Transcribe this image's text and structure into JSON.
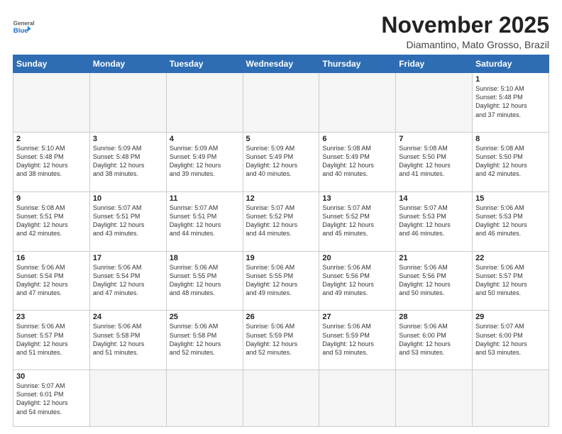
{
  "header": {
    "logo_line1": "General",
    "logo_line2": "Blue",
    "title": "November 2025",
    "subtitle": "Diamantino, Mato Grosso, Brazil"
  },
  "days_of_week": [
    "Sunday",
    "Monday",
    "Tuesday",
    "Wednesday",
    "Thursday",
    "Friday",
    "Saturday"
  ],
  "weeks": [
    [
      {
        "day": "",
        "info": ""
      },
      {
        "day": "",
        "info": ""
      },
      {
        "day": "",
        "info": ""
      },
      {
        "day": "",
        "info": ""
      },
      {
        "day": "",
        "info": ""
      },
      {
        "day": "",
        "info": ""
      },
      {
        "day": "1",
        "info": "Sunrise: 5:10 AM\nSunset: 5:48 PM\nDaylight: 12 hours\nand 37 minutes."
      }
    ],
    [
      {
        "day": "2",
        "info": "Sunrise: 5:10 AM\nSunset: 5:48 PM\nDaylight: 12 hours\nand 38 minutes."
      },
      {
        "day": "3",
        "info": "Sunrise: 5:09 AM\nSunset: 5:48 PM\nDaylight: 12 hours\nand 38 minutes."
      },
      {
        "day": "4",
        "info": "Sunrise: 5:09 AM\nSunset: 5:49 PM\nDaylight: 12 hours\nand 39 minutes."
      },
      {
        "day": "5",
        "info": "Sunrise: 5:09 AM\nSunset: 5:49 PM\nDaylight: 12 hours\nand 40 minutes."
      },
      {
        "day": "6",
        "info": "Sunrise: 5:08 AM\nSunset: 5:49 PM\nDaylight: 12 hours\nand 40 minutes."
      },
      {
        "day": "7",
        "info": "Sunrise: 5:08 AM\nSunset: 5:50 PM\nDaylight: 12 hours\nand 41 minutes."
      },
      {
        "day": "8",
        "info": "Sunrise: 5:08 AM\nSunset: 5:50 PM\nDaylight: 12 hours\nand 42 minutes."
      }
    ],
    [
      {
        "day": "9",
        "info": "Sunrise: 5:08 AM\nSunset: 5:51 PM\nDaylight: 12 hours\nand 42 minutes."
      },
      {
        "day": "10",
        "info": "Sunrise: 5:07 AM\nSunset: 5:51 PM\nDaylight: 12 hours\nand 43 minutes."
      },
      {
        "day": "11",
        "info": "Sunrise: 5:07 AM\nSunset: 5:51 PM\nDaylight: 12 hours\nand 44 minutes."
      },
      {
        "day": "12",
        "info": "Sunrise: 5:07 AM\nSunset: 5:52 PM\nDaylight: 12 hours\nand 44 minutes."
      },
      {
        "day": "13",
        "info": "Sunrise: 5:07 AM\nSunset: 5:52 PM\nDaylight: 12 hours\nand 45 minutes."
      },
      {
        "day": "14",
        "info": "Sunrise: 5:07 AM\nSunset: 5:53 PM\nDaylight: 12 hours\nand 46 minutes."
      },
      {
        "day": "15",
        "info": "Sunrise: 5:06 AM\nSunset: 5:53 PM\nDaylight: 12 hours\nand 46 minutes."
      }
    ],
    [
      {
        "day": "16",
        "info": "Sunrise: 5:06 AM\nSunset: 5:54 PM\nDaylight: 12 hours\nand 47 minutes."
      },
      {
        "day": "17",
        "info": "Sunrise: 5:06 AM\nSunset: 5:54 PM\nDaylight: 12 hours\nand 47 minutes."
      },
      {
        "day": "18",
        "info": "Sunrise: 5:06 AM\nSunset: 5:55 PM\nDaylight: 12 hours\nand 48 minutes."
      },
      {
        "day": "19",
        "info": "Sunrise: 5:06 AM\nSunset: 5:55 PM\nDaylight: 12 hours\nand 49 minutes."
      },
      {
        "day": "20",
        "info": "Sunrise: 5:06 AM\nSunset: 5:56 PM\nDaylight: 12 hours\nand 49 minutes."
      },
      {
        "day": "21",
        "info": "Sunrise: 5:06 AM\nSunset: 5:56 PM\nDaylight: 12 hours\nand 50 minutes."
      },
      {
        "day": "22",
        "info": "Sunrise: 5:06 AM\nSunset: 5:57 PM\nDaylight: 12 hours\nand 50 minutes."
      }
    ],
    [
      {
        "day": "23",
        "info": "Sunrise: 5:06 AM\nSunset: 5:57 PM\nDaylight: 12 hours\nand 51 minutes."
      },
      {
        "day": "24",
        "info": "Sunrise: 5:06 AM\nSunset: 5:58 PM\nDaylight: 12 hours\nand 51 minutes."
      },
      {
        "day": "25",
        "info": "Sunrise: 5:06 AM\nSunset: 5:58 PM\nDaylight: 12 hours\nand 52 minutes."
      },
      {
        "day": "26",
        "info": "Sunrise: 5:06 AM\nSunset: 5:59 PM\nDaylight: 12 hours\nand 52 minutes."
      },
      {
        "day": "27",
        "info": "Sunrise: 5:06 AM\nSunset: 5:59 PM\nDaylight: 12 hours\nand 53 minutes."
      },
      {
        "day": "28",
        "info": "Sunrise: 5:06 AM\nSunset: 6:00 PM\nDaylight: 12 hours\nand 53 minutes."
      },
      {
        "day": "29",
        "info": "Sunrise: 5:07 AM\nSunset: 6:00 PM\nDaylight: 12 hours\nand 53 minutes."
      }
    ],
    [
      {
        "day": "30",
        "info": "Sunrise: 5:07 AM\nSunset: 6:01 PM\nDaylight: 12 hours\nand 54 minutes."
      },
      {
        "day": "",
        "info": ""
      },
      {
        "day": "",
        "info": ""
      },
      {
        "day": "",
        "info": ""
      },
      {
        "day": "",
        "info": ""
      },
      {
        "day": "",
        "info": ""
      },
      {
        "day": "",
        "info": ""
      }
    ]
  ]
}
